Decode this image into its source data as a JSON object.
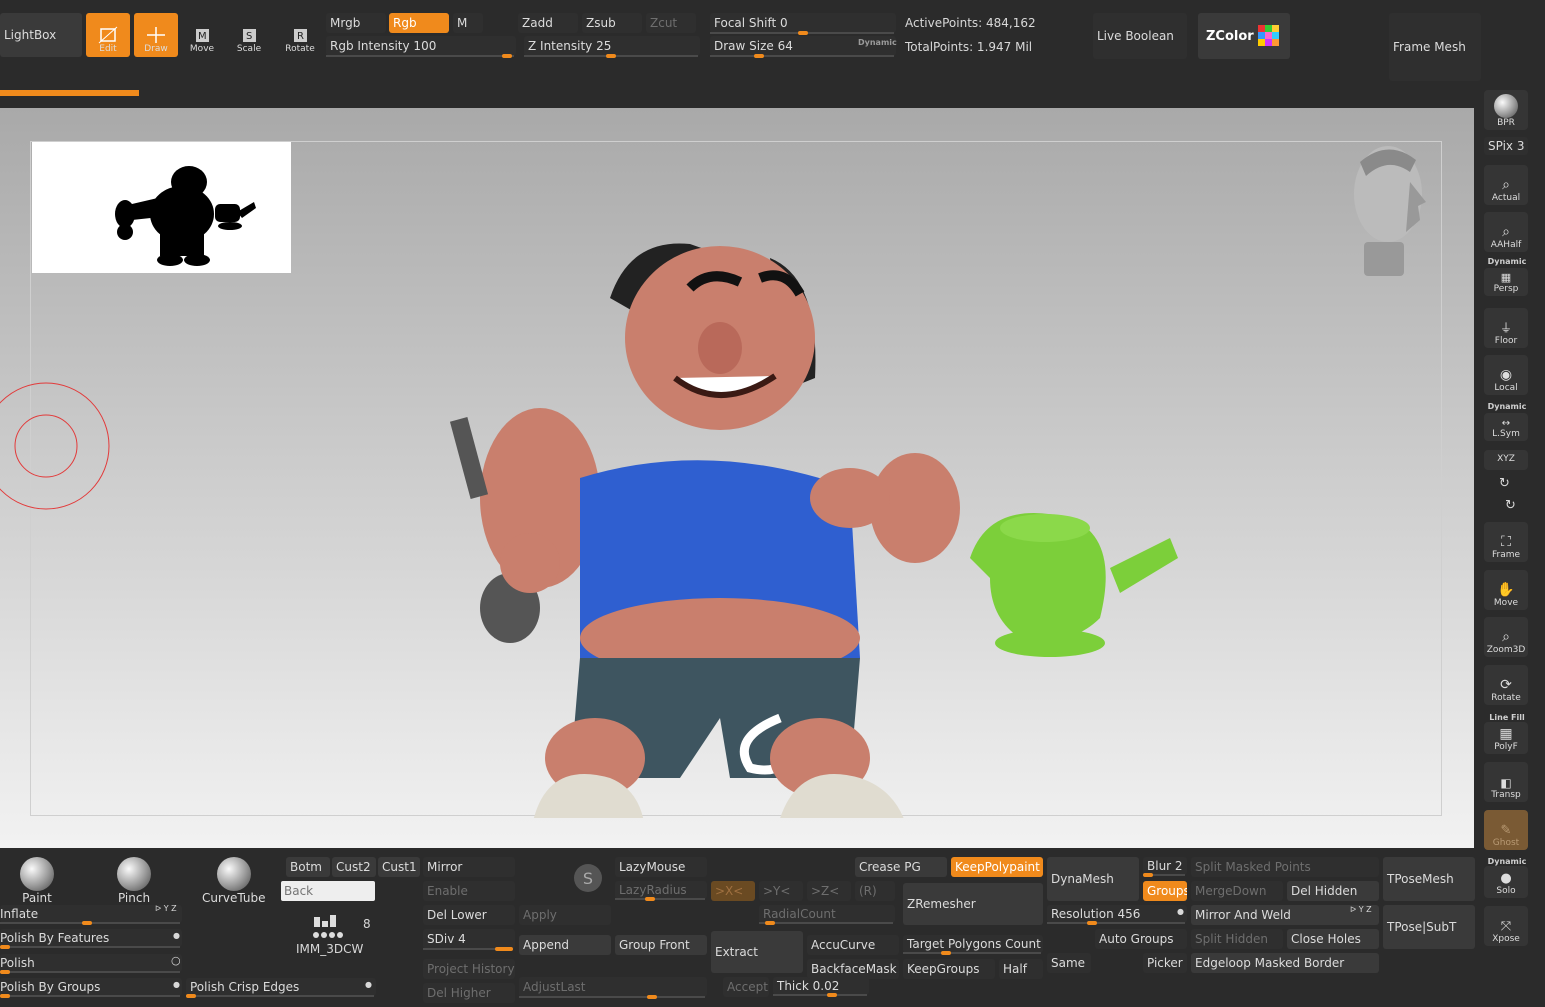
{
  "top_toolbar": {
    "lightbox": "LightBox",
    "modes": [
      {
        "label": "Edit",
        "active": true
      },
      {
        "label": "Draw",
        "active": true
      },
      {
        "label": "Move",
        "active": false
      },
      {
        "label": "Scale",
        "active": false
      },
      {
        "label": "Rotate",
        "active": false
      }
    ],
    "mrgb": "Mrgb",
    "rgb": "Rgb",
    "m": "M",
    "rgb_intensity": "Rgb Intensity 100",
    "zadd": "Zadd",
    "zsub": "Zsub",
    "zcut": "Zcut",
    "z_intensity": "Z Intensity 25",
    "focal_shift": "Focal Shift 0",
    "draw_size": "Draw Size 64",
    "dynamic": "Dynamic",
    "active_points": "ActivePoints: 484,162",
    "total_points": "TotalPoints: 1.947 Mil",
    "live_boolean": "Live Boolean",
    "zcolor": "ZColor",
    "frame_mesh": "Frame Mesh"
  },
  "right_shelf": {
    "bpr": "BPR",
    "spix": "SPix 3",
    "actual": "Actual",
    "aahalf": "AAHalf",
    "dynamic_label": "Dynamic",
    "persp": "Persp",
    "floor": "Floor",
    "local": "Local",
    "dynamic_label2": "Dynamic",
    "lsym": "L.Sym",
    "xyz": "XYZ",
    "frame": "Frame",
    "move": "Move",
    "zoom3d": "Zoom3D",
    "rotate": "Rotate",
    "line_fill": "Line Fill",
    "polyf": "PolyF",
    "transp": "Transp",
    "ghost": "Ghost",
    "dynamic_label3": "Dynamic",
    "solo": "Solo",
    "xpose": "Xpose"
  },
  "bottom_shelf": {
    "brushes": [
      "Paint",
      "Pinch",
      "CurveTube"
    ],
    "inflate": "Inflate",
    "polish_by_features": "Polish By Features",
    "polish": "Polish",
    "polish_by_groups": "Polish By Groups",
    "polish_crisp_edges": "Polish Crisp Edges",
    "botm": "Botm",
    "cust2": "Cust2",
    "cust1": "Cust1",
    "back_placeholder": "Back",
    "imm_brush": "IMM_3DCW",
    "imm_count": "8",
    "mirror": "Mirror",
    "enable": "Enable",
    "del_lower": "Del Lower",
    "apply": "Apply",
    "sdiv": "SDiv 4",
    "append": "Append",
    "group_front": "Group Front",
    "project_history": "Project History",
    "del_higher": "Del Higher",
    "adjust_last": "AdjustLast",
    "lazymouse": "LazyMouse",
    "lazyradius": "LazyRadius",
    "sym_x": ">X<",
    "sym_y": ">Y<",
    "sym_z": ">Z<",
    "sym_r": "(R)",
    "radial_count": "RadialCount",
    "extract": "Extract",
    "accept": "Accept",
    "thick": "Thick 0.02",
    "accucurve": "AccuCurve",
    "backfacemask": "BackfaceMask",
    "crease_pg": "Crease PG",
    "keep_polypaint": "KeepPolypaint",
    "zremesher": "ZRemesher",
    "target_polygons": "Target Polygons Count 5",
    "keepgroups": "KeepGroups",
    "half": "Half",
    "same": "Same",
    "dynamesh": "DynaMesh",
    "resolution": "Resolution 456",
    "blur": "Blur 2",
    "groups": "Groups",
    "auto_groups": "Auto Groups",
    "picker": "Picker",
    "split_masked": "Split Masked Points",
    "merge_down": "MergeDown",
    "del_hidden": "Del Hidden",
    "mirror_and_weld": "Mirror And Weld",
    "split_hidden": "Split Hidden",
    "close_holes": "Close Holes",
    "edgeloop": "Edgeloop Masked Border",
    "tposemesh": "TPoseMesh",
    "tpose_subt": "TPose|SubT"
  },
  "colors": {
    "accent": "#f08a1c",
    "panel": "#2b2b2b",
    "button": "#3a3a3a"
  }
}
